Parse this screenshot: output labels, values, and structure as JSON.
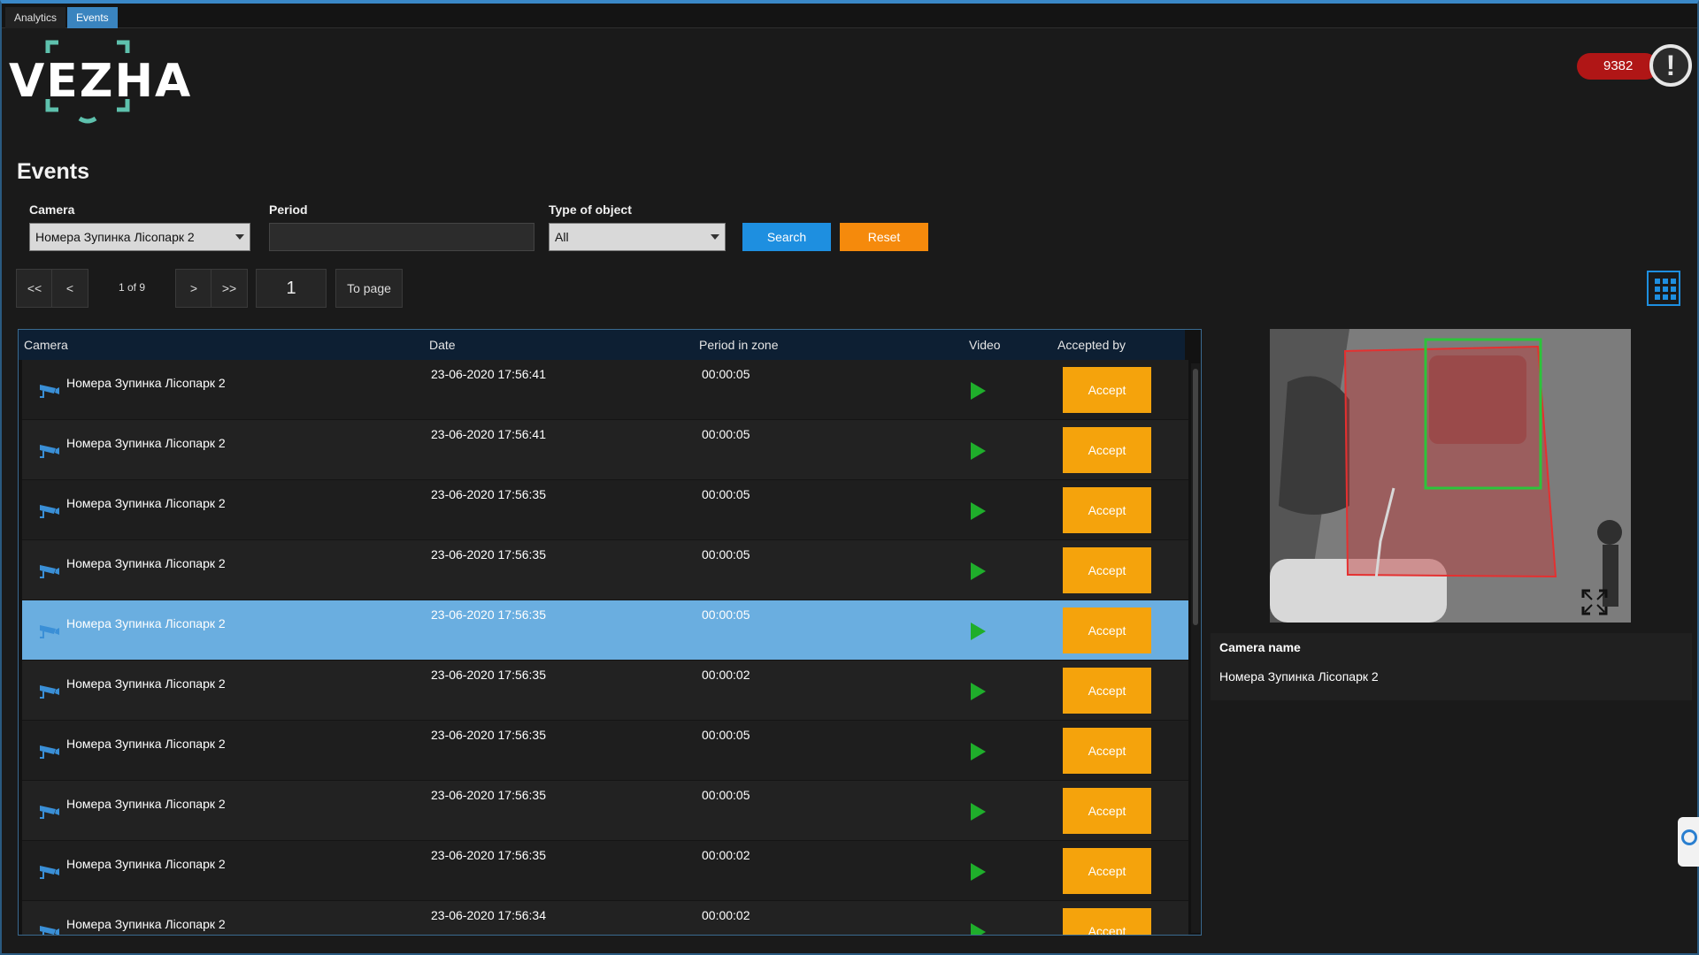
{
  "tabs": [
    {
      "label": "Analytics",
      "active": false
    },
    {
      "label": "Events",
      "active": true
    }
  ],
  "brand": {
    "logo_text": "VEZHA",
    "accent_color": "#5ec1ad"
  },
  "alerts": {
    "count": "9382",
    "icon": "exclamation-icon"
  },
  "page": {
    "title": "Events"
  },
  "filters": {
    "camera_label": "Camera",
    "camera_value": "Номера Зупинка Лісопарк 2",
    "period_label": "Period",
    "period_value": "",
    "type_label": "Type of object",
    "type_value": "All",
    "search_label": "Search",
    "reset_label": "Reset"
  },
  "pager": {
    "first": "<<",
    "prev": "<",
    "info": "1 of 9",
    "next": ">",
    "last": ">>",
    "page_value": "1",
    "to_page": "To page"
  },
  "table": {
    "columns": [
      "Camera",
      "Date",
      "Period in zone",
      "Video",
      "Accepted by"
    ],
    "accept_label": "Accept",
    "rows": [
      {
        "camera": "Номера Зупинка Лісопарк 2",
        "date": "23-06-2020 17:56:41",
        "period": "00:00:05"
      },
      {
        "camera": "Номера Зупинка Лісопарк 2",
        "date": "23-06-2020 17:56:41",
        "period": "00:00:05"
      },
      {
        "camera": "Номера Зупинка Лісопарк 2",
        "date": "23-06-2020 17:56:35",
        "period": "00:00:05"
      },
      {
        "camera": "Номера Зупинка Лісопарк 2",
        "date": "23-06-2020 17:56:35",
        "period": "00:00:05"
      },
      {
        "camera": "Номера Зупинка Лісопарк 2",
        "date": "23-06-2020 17:56:35",
        "period": "00:00:05",
        "selected": true
      },
      {
        "camera": "Номера Зупинка Лісопарк 2",
        "date": "23-06-2020 17:56:35",
        "period": "00:00:02"
      },
      {
        "camera": "Номера Зупинка Лісопарк 2",
        "date": "23-06-2020 17:56:35",
        "period": "00:00:05"
      },
      {
        "camera": "Номера Зупинка Лісопарк 2",
        "date": "23-06-2020 17:56:35",
        "period": "00:00:05"
      },
      {
        "camera": "Номера Зупинка Лісопарк 2",
        "date": "23-06-2020 17:56:35",
        "period": "00:00:02"
      },
      {
        "camera": "Номера Зупинка Лісопарк 2",
        "date": "23-06-2020 17:56:34",
        "period": "00:00:02"
      }
    ]
  },
  "details": {
    "label": "Camera name",
    "value": "Номера Зупинка Лісопарк 2"
  },
  "colors": {
    "search_button": "#1e8fe0",
    "reset_button": "#f58a0c",
    "accept_button": "#f5a30c",
    "selected_row": "#6aaee0",
    "play_icon": "#1fae2b",
    "alert_badge": "#b01616"
  }
}
